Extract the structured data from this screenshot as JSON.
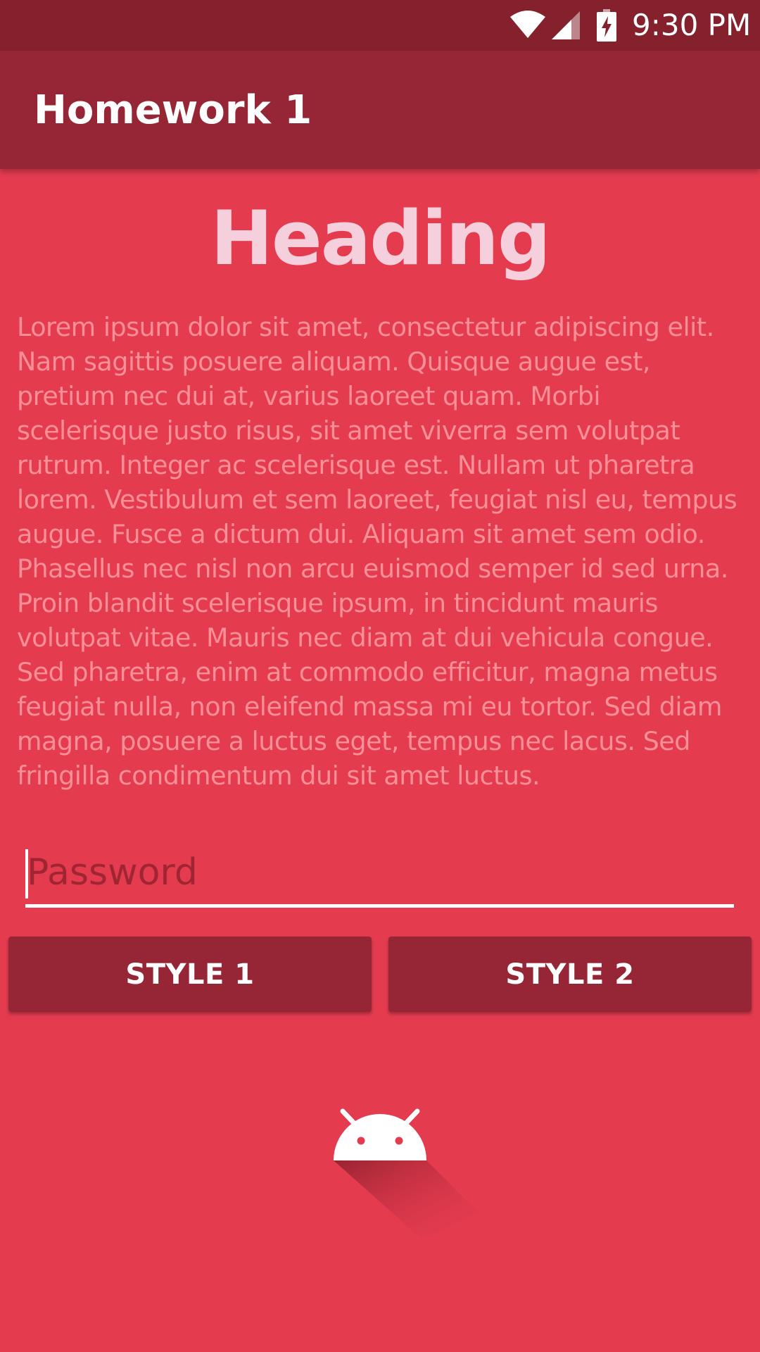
{
  "status_bar": {
    "time": "9:30 PM",
    "icons": [
      "wifi-icon",
      "cell-signal-icon",
      "battery-charging-icon"
    ]
  },
  "app_bar": {
    "title": "Homework 1"
  },
  "main": {
    "heading": "Heading",
    "body": "Lorem ipsum dolor sit amet, consectetur adipiscing elit. Nam sagittis posuere aliquam. Quisque augue est, pretium nec dui at, varius laoreet quam. Morbi scelerisque justo risus, sit amet viverra sem volutpat rutrum. Integer ac scelerisque est. Nullam ut pharetra lorem. Vestibulum et sem laoreet, feugiat nisl eu, tempus augue. Fusce a dictum dui. Aliquam sit amet sem odio. Phasellus nec nisl non arcu euismod semper id sed urna. Proin blandit scelerisque ipsum, in tincidunt mauris volutpat vitae. Mauris nec diam at dui vehicula congue. Sed pharetra, enim at commodo efficitur, magna metus feugiat nulla, non eleifend massa mi eu tortor. Sed diam magna, posuere a luctus eget, tempus nec lacus. Sed fringilla condimentum dui sit amet luctus.",
    "password": {
      "value": "",
      "placeholder": "Password"
    },
    "buttons": {
      "style1_label": "STYLE 1",
      "style2_label": "STYLE 2"
    },
    "logo_icon": "android-icon"
  },
  "colors": {
    "background": "#e43b4f",
    "status_bar": "#85202d",
    "app_bar": "#962535",
    "heading": "#f5cfdb",
    "body_text": "#fb8f98",
    "button": "#962535"
  }
}
